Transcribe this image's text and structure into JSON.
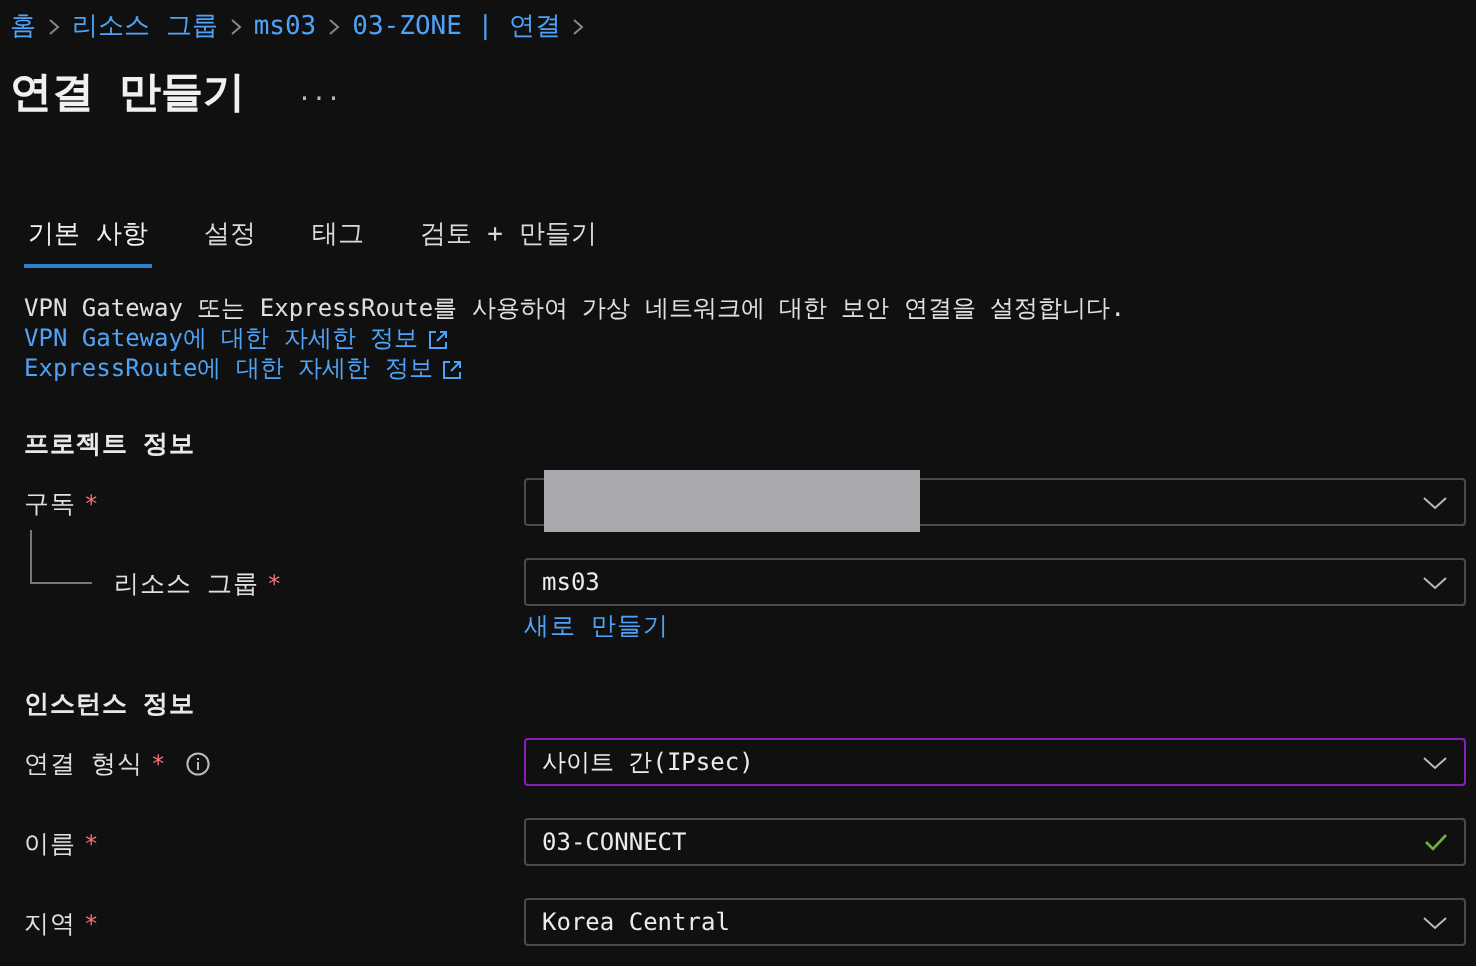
{
  "breadcrumb": [
    "홈",
    "리소스 그룹",
    "ms03",
    "03-ZONE | 연결"
  ],
  "title": "연결 만들기",
  "more": "...",
  "tabs": [
    {
      "label": "기본 사항",
      "selected": true
    },
    {
      "label": "설정",
      "selected": false
    },
    {
      "label": "태그",
      "selected": false
    },
    {
      "label": "검토 + 만들기",
      "selected": false
    }
  ],
  "description": "VPN Gateway 또는 ExpressRoute를 사용하여 가상 네트워크에 대한 보안 연결을 설정합니다.",
  "links": [
    "VPN Gateway에 대한 자세한 정보",
    "ExpressRoute에 대한 자세한 정보"
  ],
  "sections": [
    {
      "title": "프로젝트 정보",
      "fields": [
        {
          "label": "구독",
          "required": "*",
          "kind": "dropdown",
          "focused": false,
          "redacted": true
        },
        {
          "label": "리소스 그룹",
          "required": "*",
          "indent": true,
          "kind": "dropdown",
          "value": "ms03",
          "focused": false,
          "link": "새로 만들기"
        }
      ]
    },
    {
      "title": "인스턴스 정보",
      "fields": [
        {
          "label": "연결 형식",
          "required": "*",
          "info": true,
          "kind": "dropdown",
          "value": "사이트 간(IPsec)",
          "focused": true
        },
        {
          "label": "이름",
          "required": "*",
          "kind": "text",
          "value": "03-CONNECT",
          "focused": false,
          "valid": true
        },
        {
          "label": "지역",
          "required": "*",
          "kind": "dropdown",
          "value": "Korea Central",
          "focused": false
        }
      ]
    }
  ]
}
